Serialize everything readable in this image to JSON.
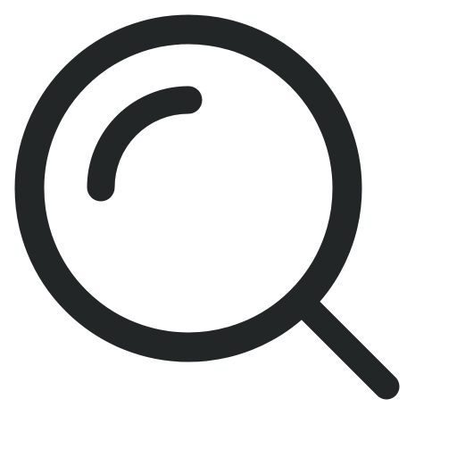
{
  "icon": {
    "name": "search-icon",
    "stroke_color": "#222626",
    "background_color": "#ffffff"
  }
}
